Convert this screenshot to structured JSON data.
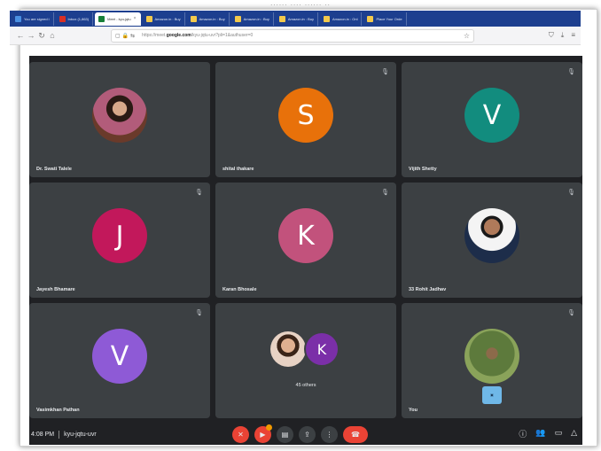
{
  "caption": "...... .... ...... ..",
  "browser": {
    "tabs": [
      {
        "label": "You are signed i",
        "color": "#4a90e2",
        "active": false
      },
      {
        "label": "Inbox (1,863)",
        "color": "#d93025",
        "active": false
      },
      {
        "label": "Meet - kyu-jqtu",
        "color": "#188038",
        "active": true
      },
      {
        "label": "Amazon.in : Buy",
        "color": "#f2c94c",
        "active": false
      },
      {
        "label": "Amazon.in : Buy",
        "color": "#f2c94c",
        "active": false
      },
      {
        "label": "Amazon.in : Buy",
        "color": "#f2c94c",
        "active": false
      },
      {
        "label": "Amazon.in : Buy",
        "color": "#f2c94c",
        "active": false
      },
      {
        "label": "Amazon.in : Onl",
        "color": "#f2c94c",
        "active": false
      },
      {
        "label": "Place Your Orde",
        "color": "#f2c94c",
        "active": false
      }
    ],
    "url_prefix": "https://meet.",
    "url_domain": "google.com",
    "url_rest": "/kyu-jqtu-uvr?pli=1&authuser=0"
  },
  "tiles": [
    {
      "name": "Dr. Swati Talele",
      "type": "photo-f",
      "letter": "",
      "muted": false
    },
    {
      "name": "shital thakare",
      "type": "letter",
      "letter": "S",
      "color": "#e8710a",
      "muted": true
    },
    {
      "name": "Vijith Shetty",
      "type": "letter",
      "letter": "V",
      "color": "#128c7e",
      "muted": true
    },
    {
      "name": "Jayesh Bhamare",
      "type": "letter",
      "letter": "J",
      "color": "#c2185b",
      "muted": true
    },
    {
      "name": "Karan Bhosale",
      "type": "letter",
      "letter": "K",
      "color": "#c2527c",
      "muted": true
    },
    {
      "name": "33 Rohit Jadhav",
      "type": "photo-m",
      "letter": "",
      "muted": true
    },
    {
      "name": "Vasimkhan Pathan",
      "type": "letter",
      "letter": "V",
      "color": "#8e5ad6",
      "muted": true
    },
    {
      "name": "",
      "type": "others",
      "letter": "K",
      "muted": false,
      "others_text": "45 others"
    },
    {
      "name": "You",
      "type": "you",
      "letter": "",
      "muted": true
    }
  ],
  "controls": {
    "time": "4:08 PM",
    "meeting_code": "kyu-jqtu-uvr"
  }
}
